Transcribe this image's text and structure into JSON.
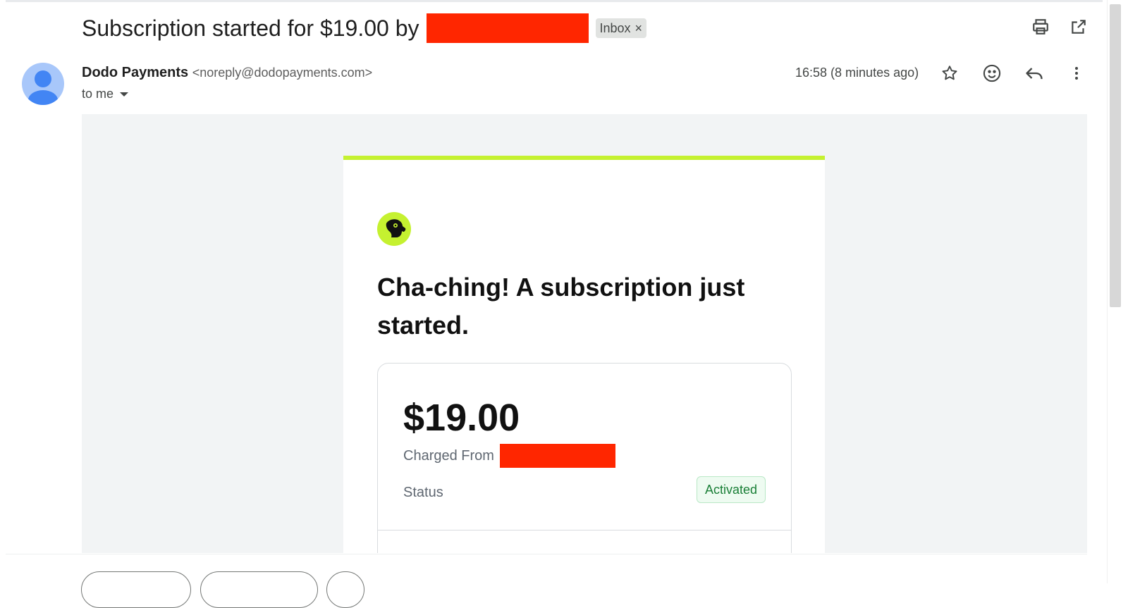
{
  "email": {
    "subject": "Subscription started for $19.00 by",
    "label": "Inbox",
    "label_remove": "×",
    "sender_name": "Dodo Payments",
    "sender_address": "<noreply@dodopayments.com>",
    "recipient": "to me",
    "timestamp": "16:58 (8 minutes ago)"
  },
  "icons": {
    "print": "print-icon",
    "open_new_window": "open-in-new-window-icon",
    "star": "star-icon",
    "emoji": "emoji-reaction-icon",
    "reply": "reply-icon",
    "more": "more-vertical-icon",
    "expand": "chevron-down-icon",
    "avatar": "person-icon",
    "logo": "dodo-bird-logo"
  },
  "body": {
    "headline": "Cha-ching! A subscription just started.",
    "amount": "$19.00",
    "charged_from_label": "Charged From",
    "status_label": "Status",
    "status_value": "Activated"
  },
  "colors": {
    "accent_bar": "#c5f130",
    "redaction": "#ff2600",
    "status_green": "#1a7f37",
    "avatar_bg": "#a8c7fa",
    "avatar_figure": "#4285f4"
  }
}
